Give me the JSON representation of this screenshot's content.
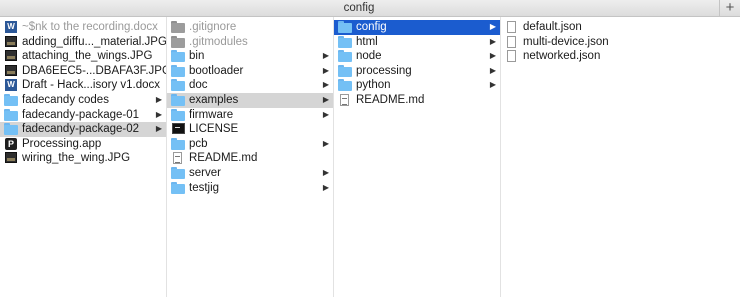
{
  "window": {
    "title": "config",
    "add_tab_label": "+"
  },
  "columns": [
    {
      "items": [
        {
          "label": "~$nk to the recording.docx",
          "icon": "word-doc-icon",
          "dim": true
        },
        {
          "label": "adding_diffu..._material.JPG",
          "icon": "image-icon"
        },
        {
          "label": "attaching_the_wings.JPG",
          "icon": "image-icon"
        },
        {
          "label": "DBA6EEC5-...DBAFA3F.JPG",
          "icon": "image-icon"
        },
        {
          "label": "Draft - Hack...isory v1.docx",
          "icon": "word-doc-icon"
        },
        {
          "label": "fadecandy codes",
          "icon": "folder-icon",
          "folder": true
        },
        {
          "label": "fadecandy-package-01",
          "icon": "folder-icon",
          "folder": true
        },
        {
          "label": "fadecandy-package-02",
          "icon": "folder-icon",
          "folder": true,
          "selected": "path"
        },
        {
          "label": "Processing.app",
          "icon": "app-icon"
        },
        {
          "label": "wiring_the_wing.JPG",
          "icon": "image-icon"
        }
      ]
    },
    {
      "items": [
        {
          "label": ".gitignore",
          "icon": "folder-gray-icon",
          "dim": true
        },
        {
          "label": ".gitmodules",
          "icon": "folder-gray-icon",
          "dim": true
        },
        {
          "label": "bin",
          "icon": "folder-icon",
          "folder": true
        },
        {
          "label": "bootloader",
          "icon": "folder-icon",
          "folder": true
        },
        {
          "label": "doc",
          "icon": "folder-icon",
          "folder": true
        },
        {
          "label": "examples",
          "icon": "folder-icon",
          "folder": true,
          "selected": "path"
        },
        {
          "label": "firmware",
          "icon": "folder-icon",
          "folder": true
        },
        {
          "label": "LICENSE",
          "icon": "terminal-file-icon"
        },
        {
          "label": "pcb",
          "icon": "folder-icon",
          "folder": true
        },
        {
          "label": "README.md",
          "icon": "text-file-icon"
        },
        {
          "label": "server",
          "icon": "folder-icon",
          "folder": true
        },
        {
          "label": "testjig",
          "icon": "folder-icon",
          "folder": true
        }
      ]
    },
    {
      "items": [
        {
          "label": "config",
          "icon": "folder-icon",
          "folder": true,
          "selected": "active"
        },
        {
          "label": "html",
          "icon": "folder-icon",
          "folder": true
        },
        {
          "label": "node",
          "icon": "folder-icon",
          "folder": true
        },
        {
          "label": "processing",
          "icon": "folder-icon",
          "folder": true
        },
        {
          "label": "python",
          "icon": "folder-icon",
          "folder": true
        },
        {
          "label": "README.md",
          "icon": "text-file-icon"
        }
      ]
    },
    {
      "items": [
        {
          "label": "default.json",
          "icon": "file-icon"
        },
        {
          "label": "multi-device.json",
          "icon": "file-icon"
        },
        {
          "label": "networked.json",
          "icon": "file-icon"
        }
      ]
    }
  ],
  "chevron_glyph": "▶"
}
